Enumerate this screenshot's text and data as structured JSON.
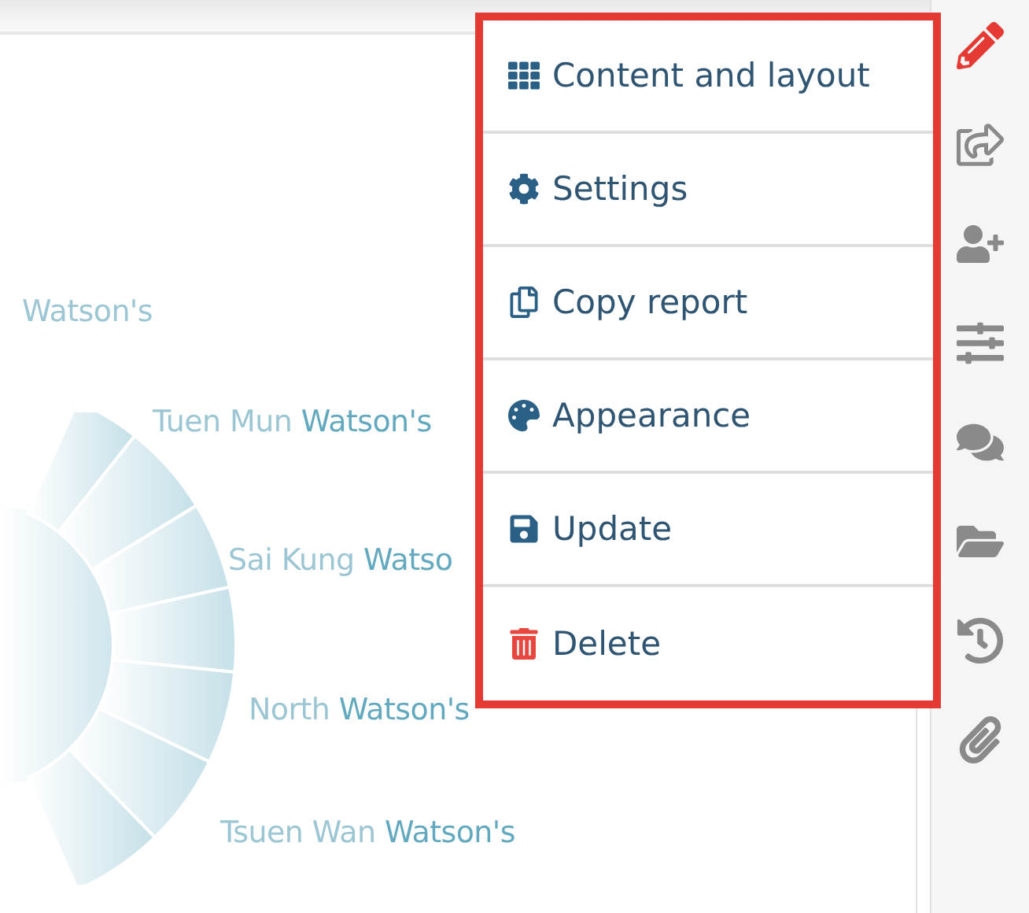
{
  "chart": {
    "labels": [
      {
        "text": "Watson's"
      },
      {
        "text": "Tuen Mun **Watson's**"
      },
      {
        "text": "Sai Kung **Watso**"
      },
      {
        "text": "North **Watson's**"
      },
      {
        "text": "Tsuen Wan **Watson's**"
      }
    ]
  },
  "menu": {
    "items": [
      {
        "label": "Content and layout",
        "kind": "normal"
      },
      {
        "label": "Settings",
        "kind": "normal"
      },
      {
        "label": "Copy report",
        "kind": "normal"
      },
      {
        "label": "Appearance",
        "kind": "normal"
      },
      {
        "label": "Update",
        "kind": "normal"
      },
      {
        "label": "Delete",
        "kind": "danger"
      }
    ]
  },
  "toolbar": {
    "items": [
      {
        "selected": true
      },
      {
        "selected": false
      },
      {
        "selected": false
      },
      {
        "selected": false
      },
      {
        "selected": false
      },
      {
        "selected": false
      },
      {
        "selected": false
      },
      {
        "selected": false
      }
    ]
  }
}
